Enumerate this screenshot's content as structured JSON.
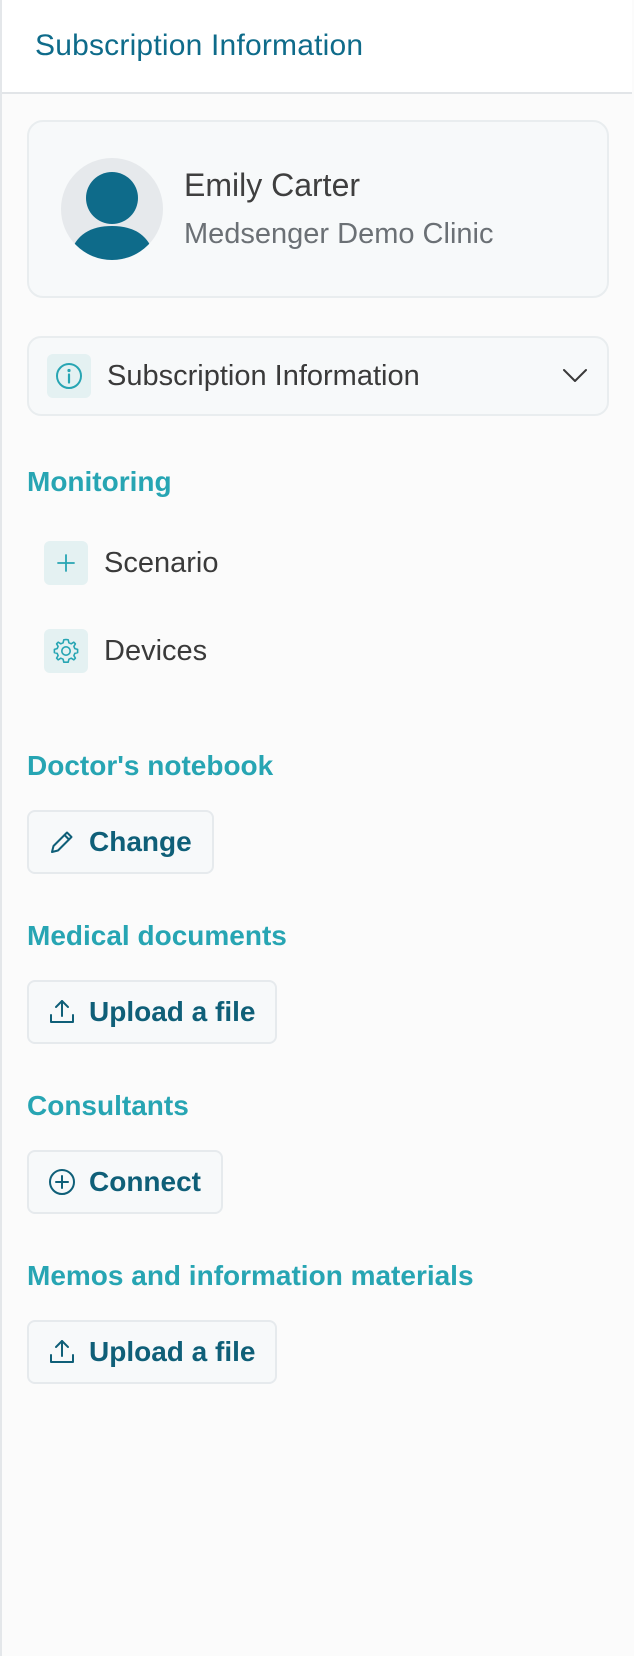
{
  "header": {
    "title": "Subscription Information"
  },
  "profile": {
    "name": "Emily Carter",
    "clinic": "Medsenger Demo Clinic"
  },
  "accordion": {
    "label": "Subscription Information",
    "icon": "info-icon",
    "expand_icon": "chevron-down-icon"
  },
  "monitoring": {
    "title": "Monitoring",
    "items": [
      {
        "label": "Scenario",
        "icon": "plus-icon"
      },
      {
        "label": "Devices",
        "icon": "gear-icon"
      }
    ]
  },
  "notebook": {
    "title": "Doctor's notebook",
    "button_label": "Change",
    "icon": "pencil-icon"
  },
  "medical_documents": {
    "title": "Medical documents",
    "button_label": "Upload a file",
    "icon": "upload-icon"
  },
  "consultants": {
    "title": "Consultants",
    "button_label": "Connect",
    "icon": "plus-circle-icon"
  },
  "memos": {
    "title": "Memos and information materials",
    "button_label": "Upload a file",
    "icon": "upload-icon"
  },
  "colors": {
    "brand_dark": "#0e6b8a",
    "section_teal": "#27a5b3",
    "button_text": "#0f5f78",
    "icon_tile": "#e4f1f2"
  }
}
